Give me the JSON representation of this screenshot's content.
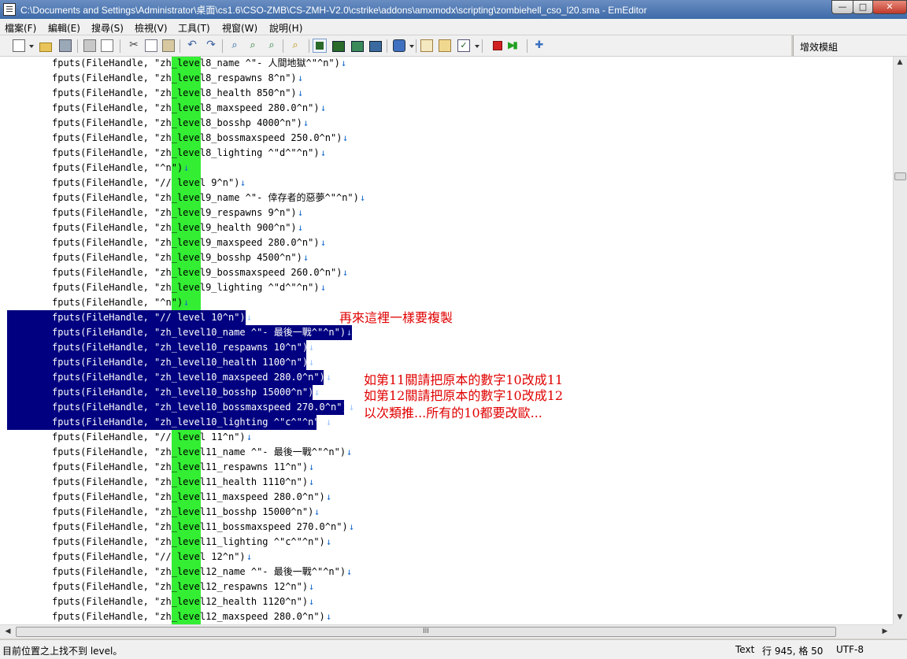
{
  "window": {
    "title": "C:\\Documents and Settings\\Administrator\\桌面\\cs1.6\\CSO-ZMB\\CS-ZMH-V2.0\\cstrike\\addons\\amxmodx\\scripting\\zombiehell_cso_l20.sma - EmEditor",
    "minimize_glyph": "—",
    "maximize_glyph": "□",
    "close_glyph": "✕"
  },
  "menu": [
    "檔案(F)",
    "編輯(E)",
    "搜尋(S)",
    "檢視(V)",
    "工具(T)",
    "視窗(W)",
    "說明(H)"
  ],
  "toolbar_icons": [
    "new-file-icon",
    "open-folder-icon",
    "save-icon",
    "print-icon",
    "print-preview-icon",
    "cut-icon",
    "copy-icon",
    "paste-icon",
    "undo-icon",
    "redo-icon",
    "find-icon",
    "find-next-icon",
    "find-prev-icon",
    "highlight-icon",
    "wrap-none-icon",
    "wrap-window-icon",
    "wrap-page-icon",
    "wrap-column-icon",
    "encoding-icon",
    "macro-edit-icon",
    "macro-select-icon",
    "checklist-icon",
    "stop-record-icon",
    "run-macro-icon",
    "plugin-icon"
  ],
  "plugins": {
    "label": "增效模組"
  },
  "colors": {
    "selection": "#000080",
    "highlight": "#33ee33",
    "annotation": "#e00000",
    "eol_marker": "#1a6bcc"
  },
  "editor": {
    "highlight_word": "level",
    "eol_marker": "↓",
    "lines": [
      "fputs(FileHandle, \"zh_level8_name ^\"- 人間地獄^\"^n\")",
      "fputs(FileHandle, \"zh_level8_respawns 8^n\")",
      "fputs(FileHandle, \"zh_level8_health 850^n\")",
      "fputs(FileHandle, \"zh_level8_maxspeed 280.0^n\")",
      "fputs(FileHandle, \"zh_level8_bosshp 4000^n\")",
      "fputs(FileHandle, \"zh_level8_bossmaxspeed 250.0^n\")",
      "fputs(FileHandle, \"zh_level8_lighting ^\"d^\"^n\")",
      "fputs(FileHandle, \"^n\")",
      "fputs(FileHandle, \"// level 9^n\")",
      "fputs(FileHandle, \"zh_level9_name ^\"- 倖存者的惡夢^\"^n\")",
      "fputs(FileHandle, \"zh_level9_respawns 9^n\")",
      "fputs(FileHandle, \"zh_level9_health 900^n\")",
      "fputs(FileHandle, \"zh_level9_maxspeed 280.0^n\")",
      "fputs(FileHandle, \"zh_level9_bosshp 4500^n\")",
      "fputs(FileHandle, \"zh_level9_bossmaxspeed 260.0^n\")",
      "fputs(FileHandle, \"zh_level9_lighting ^\"d^\"^n\")",
      "fputs(FileHandle, \"^n\")",
      "fputs(FileHandle, \"// level 10^n\")",
      "fputs(FileHandle, \"zh_level10_name ^\"- 最後一戰^\"^n\")",
      "fputs(FileHandle, \"zh_level10_respawns 10^n\")",
      "fputs(FileHandle, \"zh_level10_health 1100^n\")",
      "fputs(FileHandle, \"zh_level10_maxspeed 280.0^n\")",
      "fputs(FileHandle, \"zh_level10_bosshp 15000^n\")",
      "fputs(FileHandle, \"zh_level10_bossmaxspeed 270.0^n\")",
      "fputs(FileHandle, \"zh_level10_lighting ^\"c^\"^n\")",
      "fputs(FileHandle, \"// level 11^n\")",
      "fputs(FileHandle, \"zh_level11_name ^\"- 最後一戰^\"^n\")",
      "fputs(FileHandle, \"zh_level11_respawns 11^n\")",
      "fputs(FileHandle, \"zh_level11_health 1110^n\")",
      "fputs(FileHandle, \"zh_level11_maxspeed 280.0^n\")",
      "fputs(FileHandle, \"zh_level11_bosshp 15000^n\")",
      "fputs(FileHandle, \"zh_level11_bossmaxspeed 270.0^n\")",
      "fputs(FileHandle, \"zh_level11_lighting ^\"c^\"^n\")",
      "fputs(FileHandle, \"// level 12^n\")",
      "fputs(FileHandle, \"zh_level12_name ^\"- 最後一戰^\"^n\")",
      "fputs(FileHandle, \"zh_level12_respawns 12^n\")",
      "fputs(FileHandle, \"zh_level12_health 1120^n\")",
      "fputs(FileHandle, \"zh_level12_maxspeed 280.0^n\")"
    ],
    "selected_lines": [
      17,
      18,
      19,
      20,
      21,
      22,
      23,
      24
    ],
    "unhighlighted_lines": [
      17,
      18,
      19,
      20,
      21,
      22,
      23,
      24
    ]
  },
  "annotations": {
    "copy_note": "再來這裡一樣要複製",
    "line1": "如第11關請把原本的數字10改成11",
    "line2": "如第12關請把原本的數字10改成12",
    "line3": "以次類推...所有的10都要改歐..."
  },
  "scrollbar": {
    "up": "▲",
    "down": "▼",
    "left": "◀",
    "right": "▶",
    "grip": "III"
  },
  "status": {
    "message": "目前位置之上找不到 level。",
    "mode": "Text",
    "position": "行 945, 格 50",
    "encoding": "UTF-8"
  }
}
